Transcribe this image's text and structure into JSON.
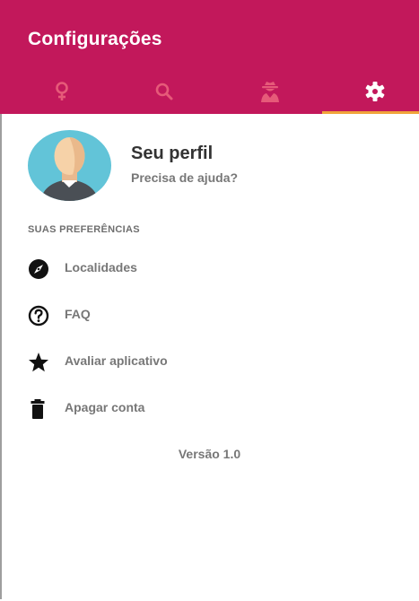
{
  "header": {
    "title": "Configurações",
    "tabs": [
      {
        "name": "female",
        "icon": "female-icon"
      },
      {
        "name": "search",
        "icon": "search-icon"
      },
      {
        "name": "user-secret",
        "icon": "user-secret-icon"
      },
      {
        "name": "settings",
        "icon": "gear-icon",
        "active": true
      }
    ],
    "colors": {
      "background": "#c2185b",
      "inactive_icon": "#e65a79",
      "active_icon": "#ffffff",
      "indicator": "#f0a43a"
    }
  },
  "profile": {
    "name": "Seu perfil",
    "help": "Precisa de ajuda?"
  },
  "preferences": {
    "header": "SUAS PREFERÊNCIAS",
    "items": [
      {
        "label": "Localidades",
        "icon": "compass-icon"
      },
      {
        "label": "FAQ",
        "icon": "question-circle-icon"
      },
      {
        "label": "Avaliar aplicativo",
        "icon": "star-icon"
      },
      {
        "label": "Apagar conta",
        "icon": "trash-icon"
      }
    ]
  },
  "version": "Versão 1.0"
}
